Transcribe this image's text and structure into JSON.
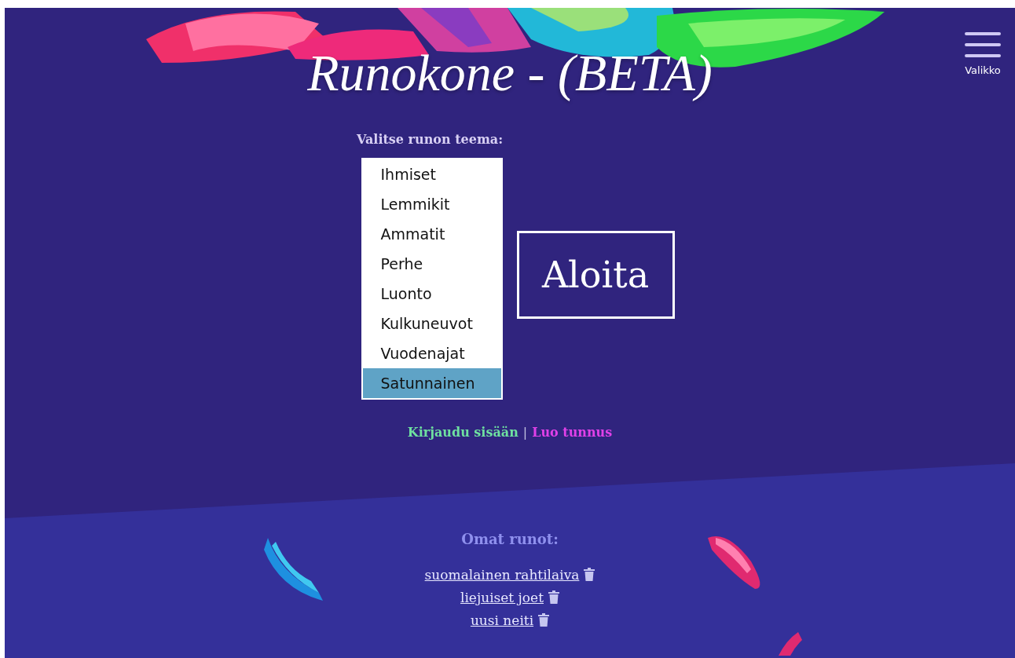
{
  "header": {
    "title": "Runokone - (BETA)",
    "menu": {
      "label": "Valikko"
    }
  },
  "theme_picker": {
    "label": "Valitse runon teema:",
    "options": [
      {
        "label": "Ihmiset",
        "selected": false
      },
      {
        "label": "Lemmikit",
        "selected": false
      },
      {
        "label": "Ammatit",
        "selected": false
      },
      {
        "label": "Perhe",
        "selected": false
      },
      {
        "label": "Luonto",
        "selected": false
      },
      {
        "label": "Kulkuneuvot",
        "selected": false
      },
      {
        "label": "Vuodenajat",
        "selected": false
      },
      {
        "label": "Satunnainen",
        "selected": true
      }
    ]
  },
  "start_button": "Aloita",
  "account_links": [
    {
      "label": "Kirjaudu sisään",
      "kind": "link",
      "color": "#6ee0a0"
    },
    {
      "label": "|",
      "kind": "separator",
      "color": "#c0c0e0"
    },
    {
      "label": "Luo tunnus",
      "kind": "link",
      "color": "#e040e8"
    }
  ],
  "own_poems": {
    "title": "Omat runot:",
    "items": [
      {
        "title": "suomalainen rahtilaiva"
      },
      {
        "title": "liejuiset joet"
      },
      {
        "title": "uusi neiti"
      }
    ]
  }
}
